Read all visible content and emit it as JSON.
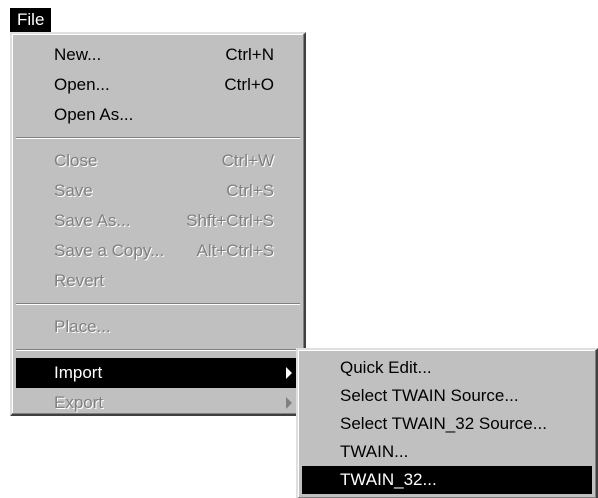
{
  "menubar": {
    "file_label": "File"
  },
  "file_menu": {
    "items": [
      {
        "label": "New...",
        "shortcut": "Ctrl+N"
      },
      {
        "label": "Open...",
        "shortcut": "Ctrl+O"
      },
      {
        "label": "Open As...",
        "shortcut": ""
      },
      {
        "label": "Close",
        "shortcut": "Ctrl+W"
      },
      {
        "label": "Save",
        "shortcut": "Ctrl+S"
      },
      {
        "label": "Save As...",
        "shortcut": "Shft+Ctrl+S"
      },
      {
        "label": "Save a Copy...",
        "shortcut": "Alt+Ctrl+S"
      },
      {
        "label": "Revert",
        "shortcut": ""
      },
      {
        "label": "Place...",
        "shortcut": ""
      },
      {
        "label": "Import",
        "shortcut": ""
      },
      {
        "label": "Export",
        "shortcut": ""
      }
    ]
  },
  "import_submenu": {
    "items": [
      {
        "label": "Quick Edit..."
      },
      {
        "label": "Select TWAIN Source..."
      },
      {
        "label": "Select TWAIN_32 Source..."
      },
      {
        "label": "TWAIN..."
      },
      {
        "label": "TWAIN_32..."
      }
    ]
  }
}
